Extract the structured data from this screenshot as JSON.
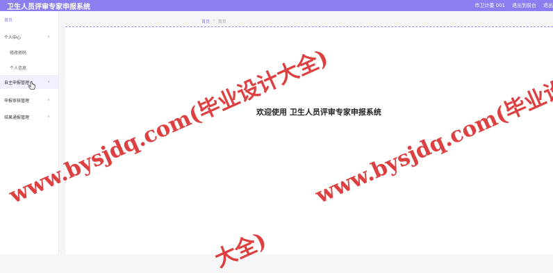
{
  "header": {
    "title": "卫生人员评审专家申报系统",
    "user": "市卫计委 001",
    "exit_to_frontend": "退出到前台",
    "exit_partial": "退出"
  },
  "sidebar": {
    "home": "首页",
    "items": [
      {
        "label": "个人中心",
        "icon": "chevron-down-icon"
      },
      {
        "label": "修改密码"
      },
      {
        "label": "个人信息"
      },
      {
        "label": "自主申报管理",
        "icon": "chevron-down-icon"
      },
      {
        "label": "申报审核管理",
        "icon": "chevron-down-icon"
      },
      {
        "label": "结果通报管理",
        "icon": "chevron-down-icon"
      }
    ]
  },
  "breadcrumb": {
    "root": "首页",
    "separator": "»",
    "current": "首页"
  },
  "main": {
    "welcome": "欢迎使用 卫生人员评审专家申报系统"
  },
  "watermarks": {
    "line1": "www.bysjdq.com(毕业设计大全)",
    "partial": "大全)"
  },
  "colors": {
    "accent": "#8a7ef0",
    "watermark": "#d71e1e"
  }
}
